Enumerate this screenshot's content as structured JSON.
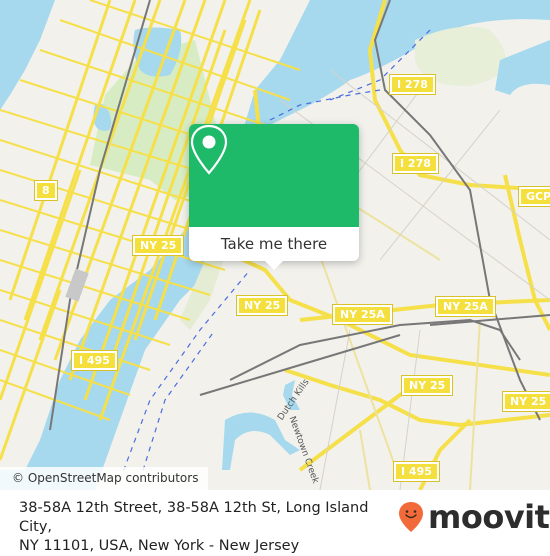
{
  "map": {
    "attribution": "© OpenStreetMap contributors",
    "water_labels": [
      "Dutch Kills",
      "Newtown Creek"
    ],
    "shields": [
      {
        "label": "I 278"
      },
      {
        "label": "I 278"
      },
      {
        "label": "GCP"
      },
      {
        "label": "8"
      },
      {
        "label": "NY 25"
      },
      {
        "label": "NY 25"
      },
      {
        "label": "NY 25A"
      },
      {
        "label": "NY 25A"
      },
      {
        "label": "NY 25"
      },
      {
        "label": "NY 25"
      },
      {
        "label": "I 495"
      },
      {
        "label": "I 495"
      }
    ],
    "colors": {
      "land": "#f2f1ec",
      "water": "#a6d8ee",
      "park": "#d8ecc4",
      "road": "#f6e04a",
      "rail": "#777777"
    }
  },
  "popup": {
    "icon": "map-pin-icon",
    "button_label": "Take me there",
    "accent": "#1fb96a"
  },
  "footer": {
    "address_line1": "38-58A 12th Street, 38-58A 12th St, Long Island City,",
    "address_line2": "NY 11101, USA, New York - New Jersey",
    "brand": "moovit",
    "brand_color": "#f26a3a"
  }
}
